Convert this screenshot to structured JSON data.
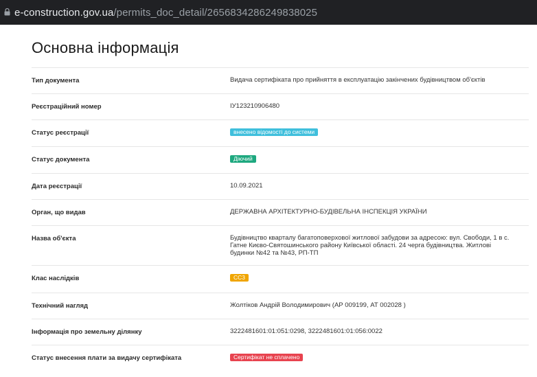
{
  "browser": {
    "url_domain": "e-construction.gov.ua",
    "url_path": "/permits_doc_detail/2656834286249838025"
  },
  "section": {
    "title": "Основна інформація"
  },
  "rows": [
    {
      "label": "Тип документа",
      "value": "Видача сертифіката про прийняття в експлуатацію закінчених будівництвом об'єктів"
    },
    {
      "label": "Реєстраційний номер",
      "value": "ІУ123210906480"
    },
    {
      "label": "Статус реєстрації",
      "badge": "внесено відомості до системи",
      "badge_color": "#3fbfdc"
    },
    {
      "label": "Статус документа",
      "badge": "Діючий",
      "badge_color": "#1ea87f"
    },
    {
      "label": "Дата реєстрації",
      "value": "10.09.2021"
    },
    {
      "label": "Орган, що видав",
      "value": "ДЕРЖАВНА АРХІТЕКТУРНО-БУДІВЕЛЬНА ІНСПЕКЦІЯ УКРАЇНИ"
    },
    {
      "label": "Назва об'єкта",
      "value": "Будівництво кварталу багатоповерхової житлової забудови за адресою: вул. Свободи, 1 в с. Гатне Києво-Святошинського району Київської області. 24 черга будівництва. Житлові будинки №42 та №43, РП-ТП"
    },
    {
      "label": "Клас наслідків",
      "badge": "СС3",
      "badge_color": "#f0a500"
    },
    {
      "label": "Технічний нагляд",
      "value": "Жолтіков Андрій Володимирович (АР 009199, АТ 002028 )"
    },
    {
      "label": "Інформація про земельну ділянку",
      "value": "3222481601:01:051:0298, 3222481601:01:056:0022"
    },
    {
      "label": "Статус внесення плати за видачу сертифіката",
      "badge": "Сертифікат не сплачено",
      "badge_color": "#e8434f"
    }
  ]
}
